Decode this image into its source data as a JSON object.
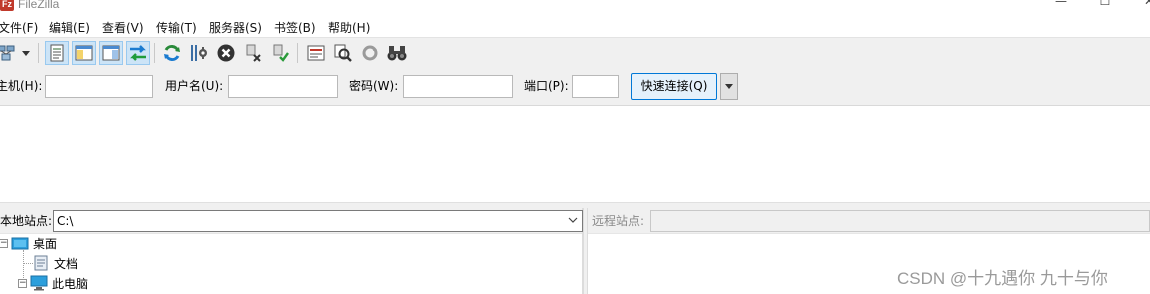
{
  "window": {
    "title": "FileZilla",
    "icon_text": "Fz",
    "controls": {
      "minimize": "—",
      "maximize": "☐",
      "close": "✕"
    }
  },
  "menu": [
    {
      "label": "文件(F)"
    },
    {
      "label": "编辑(E)"
    },
    {
      "label": "查看(V)"
    },
    {
      "label": "传输(T)"
    },
    {
      "label": "服务器(S)"
    },
    {
      "label": "书签(B)"
    },
    {
      "label": "帮助(H)"
    }
  ],
  "toolbar": {
    "buttons": [
      {
        "icon": "site-manager-icon"
      },
      {
        "icon": "dropdown-arrow-icon"
      },
      {
        "icon": "toggle-message-log-icon",
        "pressed": true
      },
      {
        "icon": "toggle-local-tree-icon",
        "pressed": true
      },
      {
        "icon": "toggle-remote-tree-icon",
        "pressed": true
      },
      {
        "icon": "toggle-transfer-queue-icon",
        "pressed": true
      },
      {
        "icon": "refresh-icon"
      },
      {
        "icon": "process-queue-icon"
      },
      {
        "icon": "cancel-icon"
      },
      {
        "icon": "disconnect-icon"
      },
      {
        "icon": "reconnect-icon"
      },
      {
        "icon": "directory-filter-icon"
      },
      {
        "icon": "toggle-comparison-icon"
      },
      {
        "icon": "synchronized-browsing-icon"
      },
      {
        "icon": "search-remote-icon"
      }
    ]
  },
  "quickconnect": {
    "host_label": "主机(H):",
    "host_value": "",
    "user_label": "用户名(U):",
    "user_value": "",
    "password_label": "密码(W):",
    "password_value": "",
    "port_label": "端口(P):",
    "port_value": "",
    "connect_label": "快速连接(Q)"
  },
  "local": {
    "site_label": "本地站点:",
    "path": "C:\\",
    "tree": [
      {
        "label": "桌面",
        "icon": "desktop-folder-icon",
        "expanded": true
      },
      {
        "label": "文档",
        "icon": "documents-icon"
      },
      {
        "label": "此电脑",
        "icon": "computer-icon",
        "expanded": true
      }
    ]
  },
  "remote": {
    "site_label": "远程站点:",
    "path": ""
  },
  "watermark": "CSDN @十九遇你 九十与你",
  "colors": {
    "accent": "#0078d7",
    "toolbar_bg": "#f0f0f0",
    "pressed_bg": "#cce4f7",
    "app_icon": "#c0392b"
  }
}
